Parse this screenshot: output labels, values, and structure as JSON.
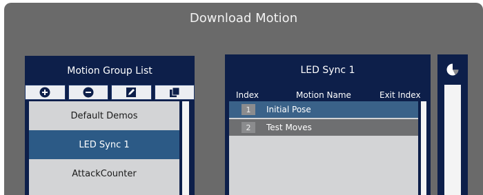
{
  "window": {
    "title": "Download Motion"
  },
  "motion_group_panel": {
    "title": "Motion Group List",
    "toolbar": [
      {
        "icon": "add-icon"
      },
      {
        "icon": "remove-icon"
      },
      {
        "icon": "edit-icon"
      },
      {
        "icon": "copy-icon"
      }
    ],
    "items": [
      {
        "label": "Default Demos",
        "selected": false
      },
      {
        "label": "LED Sync 1",
        "selected": true
      },
      {
        "label": "AttackCounter",
        "selected": false
      }
    ]
  },
  "motion_panel": {
    "title": "LED Sync 1",
    "columns": {
      "index": "Index",
      "name": "Motion Name",
      "exit": "Exit Index"
    },
    "rows": [
      {
        "index": "1",
        "name": "Initial Pose"
      },
      {
        "index": "2",
        "name": "Test Moves"
      }
    ]
  },
  "side_panel": {
    "icon": "pie-chart-icon"
  },
  "colors": {
    "window_bg": "#6a6a6a",
    "panel_bg": "#0d1f4a",
    "selected_item": "#2c5a86",
    "row_highlight": "#3a6289"
  }
}
